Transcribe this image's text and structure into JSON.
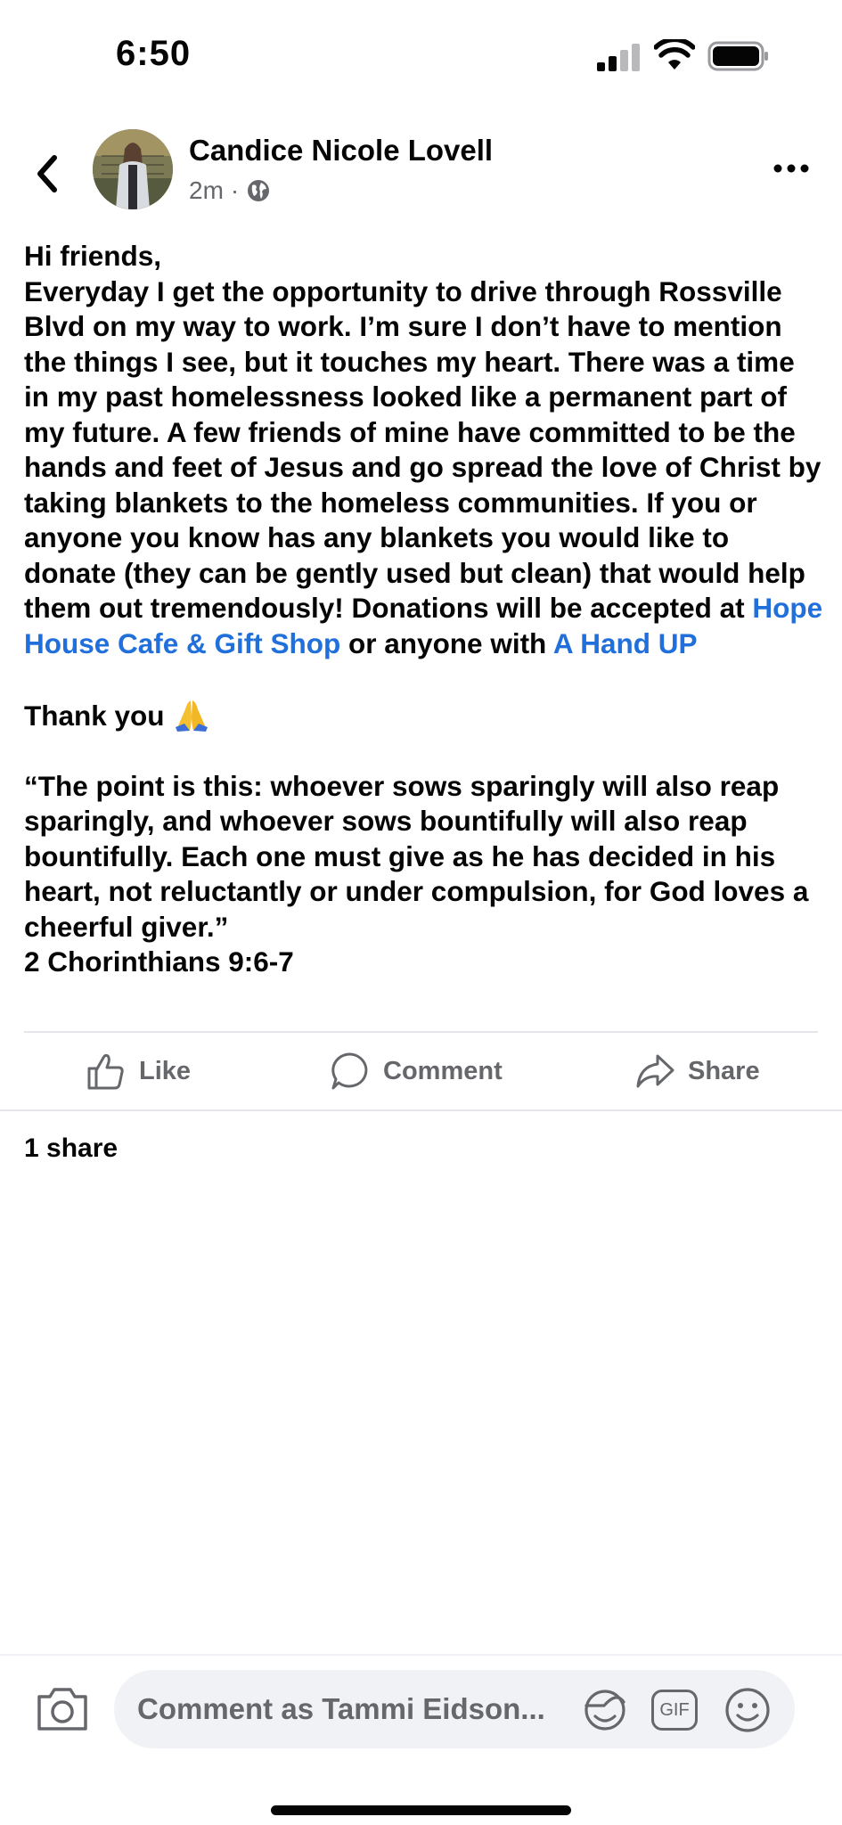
{
  "status_bar": {
    "time": "6:50",
    "icons": [
      "cellular-signal-icon",
      "wifi-icon",
      "battery-icon"
    ]
  },
  "header": {
    "back_icon": "chevron-left-icon",
    "author_name": "Candice Nicole Lovell",
    "timestamp": "2m",
    "separator": "·",
    "privacy_icon": "globe-icon",
    "more_icon": "more-horizontal-icon"
  },
  "post": {
    "greeting": "Hi friends,",
    "paragraph_text": "Everyday I get the opportunity to drive through Rossville Blvd on my way to work. I’m sure I don’t have to mention the things I see, but it touches my heart. There was a time in my past homelessness looked like a permanent part of my future. A few friends of mine have committed to be the hands and feet of Jesus and go spread the love of Christ by taking blankets to the homeless communities. If you or anyone you know has any blankets you would like to donate (they can be gently used but clean) that would help them out tremendously! Donations will be accepted at ",
    "link_1": "Hope House Cafe & Gift Shop",
    "middle_text": " or anyone with ",
    "link_2": "A Hand UP",
    "thanks": "Thank you ",
    "thanks_emoji": "folded-hands-emoji",
    "quote": "“The point is this: whoever sows sparingly will also reap sparingly, and whoever sows bountifully will also reap bountifully. Each one must give as he has decided in his heart, not reluctantly or under compulsion, for God loves a cheerful giver.”",
    "reference": "2 Chorinthians 9:6-7"
  },
  "actions": {
    "like_label": "Like",
    "comment_label": "Comment",
    "share_label": "Share"
  },
  "share_count": "1 share",
  "composer": {
    "placeholder": "Comment as Tammi Eidson...",
    "icons": [
      "camera-icon",
      "sticker-icon",
      "gif-icon",
      "emoji-icon"
    ],
    "gif_label": "GIF"
  },
  "colors": {
    "link": "#216fdb",
    "secondary_text": "#65676b",
    "divider": "#e4e6eb",
    "input_bg": "#f0f2f5"
  }
}
